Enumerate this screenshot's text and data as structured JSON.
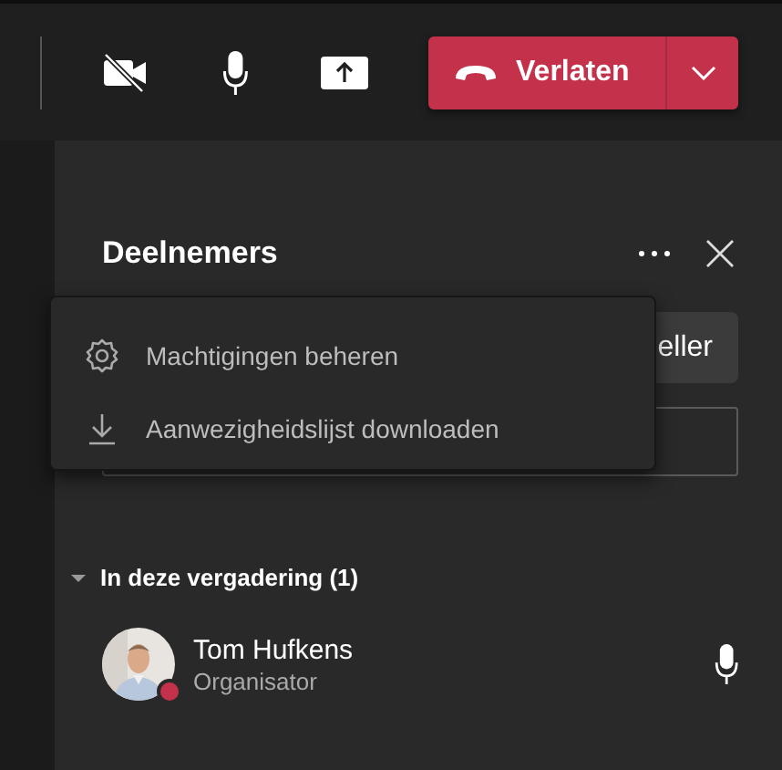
{
  "toolbar": {
    "camera_off": true,
    "leave_button": {
      "label": "Verlaten"
    }
  },
  "panel": {
    "title": "Deelnemers",
    "partial_button": {
      "label": "eller"
    },
    "section": {
      "label": "In deze vergadering (1)",
      "expanded": true,
      "participants": [
        {
          "name": "Tom Hufkens",
          "role": "Organisator",
          "color": "#c4314b"
        }
      ]
    }
  },
  "menu": {
    "items": [
      {
        "kind": "settings",
        "label": "Machtigingen beheren"
      },
      {
        "kind": "download",
        "label": "Aanwezigheidslijst downloaden"
      }
    ]
  }
}
